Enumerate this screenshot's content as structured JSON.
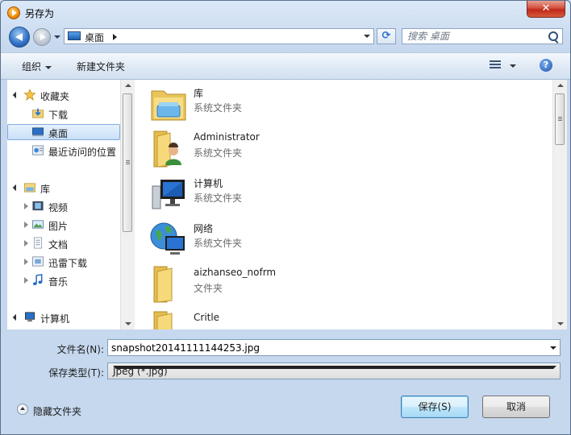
{
  "window": {
    "title": "另存为",
    "close_label": "✕"
  },
  "address": {
    "location": "桌面",
    "search_placeholder": "搜索 桌面"
  },
  "toolbar": {
    "organize_label": "组织",
    "new_folder_label": "新建文件夹",
    "help_label": "?"
  },
  "nav": {
    "favorites": {
      "label": "收藏夹",
      "items": [
        {
          "label": "下载",
          "icon": "download-folder-icon"
        },
        {
          "label": "桌面",
          "icon": "desktop-icon",
          "selected": true
        },
        {
          "label": "最近访问的位置",
          "icon": "recent-places-icon"
        }
      ]
    },
    "libraries": {
      "label": "库",
      "items": [
        {
          "label": "视频",
          "icon": "video-library-icon"
        },
        {
          "label": "图片",
          "icon": "pictures-library-icon"
        },
        {
          "label": "文档",
          "icon": "documents-library-icon"
        },
        {
          "label": "迅雷下载",
          "icon": "xunlei-download-icon"
        },
        {
          "label": "音乐",
          "icon": "music-library-icon"
        }
      ]
    },
    "computer": {
      "label": "计算机"
    }
  },
  "files": [
    {
      "name": "库",
      "type": "系统文件夹",
      "icon": "library-folder-icon"
    },
    {
      "name": "Administrator",
      "type": "系统文件夹",
      "icon": "user-folder-icon"
    },
    {
      "name": "计算机",
      "type": "系统文件夹",
      "icon": "computer-icon"
    },
    {
      "name": "网络",
      "type": "系统文件夹",
      "icon": "network-icon"
    },
    {
      "name": "aizhanseo_nofrm",
      "type": "文件夹",
      "icon": "folder-icon"
    },
    {
      "name": "Critle",
      "type": "",
      "icon": "folder-icon"
    }
  ],
  "form": {
    "filename_label": "文件名(N):",
    "filename_value": "snapshot20141111144253.jpg",
    "filetype_label": "保存类型(T):",
    "filetype_value": "Jpeg (*.jpg)"
  },
  "footer": {
    "hide_folders_label": "隐藏文件夹",
    "save_label": "保存(S)",
    "cancel_label": "取消"
  },
  "colors": {
    "accent": "#3c7fb1",
    "close": "#c0281a",
    "selection": "#c9e0f8"
  }
}
